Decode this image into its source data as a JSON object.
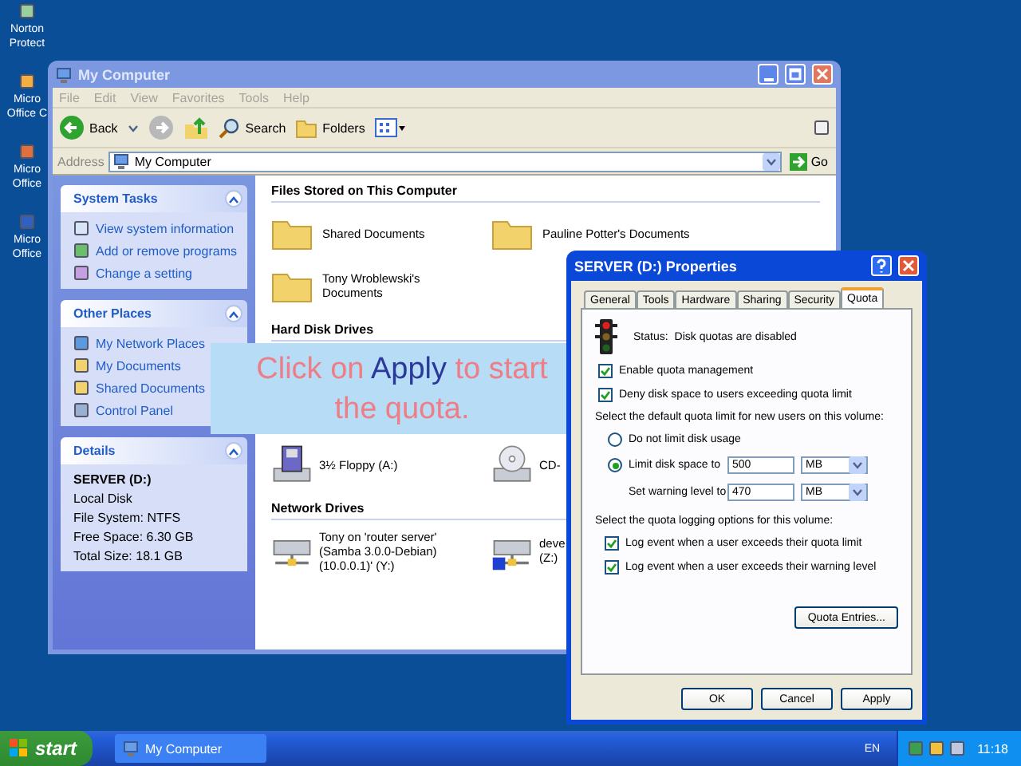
{
  "desktop_icons": [
    {
      "label": "Norton Protect"
    },
    {
      "label": "Micro Office C"
    },
    {
      "label": "Micro Office"
    },
    {
      "label": "Micro Office"
    }
  ],
  "explorer": {
    "title": "My Computer",
    "menu": [
      "File",
      "Edit",
      "View",
      "Favorites",
      "Tools",
      "Help"
    ],
    "toolbar": {
      "back": "Back",
      "search": "Search",
      "folders": "Folders"
    },
    "address": {
      "label": "Address",
      "value": "My Computer",
      "go": "Go"
    },
    "task_panels": [
      {
        "title": "System Tasks",
        "kind": "links",
        "expanded": true,
        "items": [
          "View system information",
          "Add or remove programs",
          "Change a setting"
        ]
      },
      {
        "title": "Other Places",
        "kind": "links",
        "expanded": true,
        "items": [
          "My Network Places",
          "My Documents",
          "Shared Documents",
          "Control Panel"
        ]
      },
      {
        "title": "Details",
        "kind": "details",
        "expanded": true,
        "items": [
          "SERVER (D:)",
          "Local Disk",
          "File System: NTFS",
          "Free Space: 6.30 GB",
          "Total Size: 18.1 GB"
        ]
      }
    ],
    "sections": [
      {
        "title": "Files Stored on This Computer",
        "items": [
          {
            "label": "Shared Documents",
            "kind": "folder"
          },
          {
            "label": "Pauline Potter's Documents",
            "kind": "folder"
          },
          {
            "label": "Tony Wroblewski's Documents",
            "kind": "folder"
          }
        ]
      },
      {
        "title": "Hard Disk Drives"
      },
      {
        "items": [
          {
            "label": "3½ Floppy (A:)",
            "kind": "floppy"
          },
          {
            "label": "CD-",
            "kind": "cd"
          }
        ]
      },
      {
        "title": "Network Drives",
        "items": [
          {
            "label": "Tony on 'router server' (Samba 3.0.0-Debian) (10.0.0.1)' (Y:)",
            "kind": "network"
          },
          {
            "label": "deve (Z:)",
            "kind": "network-sync"
          }
        ]
      }
    ]
  },
  "callout": {
    "text": "Click on **Apply** to start the quota."
  },
  "dialog": {
    "title": "SERVER (D:) Properties",
    "tabs": [
      {
        "label": "General",
        "selected": false
      },
      {
        "label": "Tools",
        "selected": false
      },
      {
        "label": "Hardware",
        "selected": false
      },
      {
        "label": "Sharing",
        "selected": false
      },
      {
        "label": "Security",
        "selected": false
      },
      {
        "label": "Quota",
        "selected": true
      }
    ],
    "status_label": "Status:",
    "status": "Disk quotas are disabled",
    "options": [
      {
        "label": "Enable quota management",
        "checked": true
      },
      {
        "label": "Deny disk space to users exceeding quota limit",
        "checked": true
      }
    ],
    "limit_heading": "Select the default quota limit for new users on this volume:",
    "limit_options": [
      {
        "label": "Do not limit disk usage",
        "selected": false
      },
      {
        "label": "Limit disk space to",
        "selected": true,
        "value": "500",
        "unit": "MB"
      }
    ],
    "warning": {
      "label": "Set warning level to",
      "value": "470",
      "unit": "MB"
    },
    "logging_heading": "Select the quota logging options for this volume:",
    "logging": [
      {
        "label": "Log event when a user exceeds their quota limit",
        "checked": true
      },
      {
        "label": "Log event when a user exceeds their warning level",
        "checked": true
      }
    ],
    "entries_button": "Quota Entries...",
    "buttons": [
      "OK",
      "Cancel",
      "Apply"
    ]
  },
  "taskbar": {
    "start": "start",
    "tasks": [
      {
        "label": "My Computer",
        "selected": false
      }
    ],
    "language": "EN",
    "clock": "11:18"
  }
}
